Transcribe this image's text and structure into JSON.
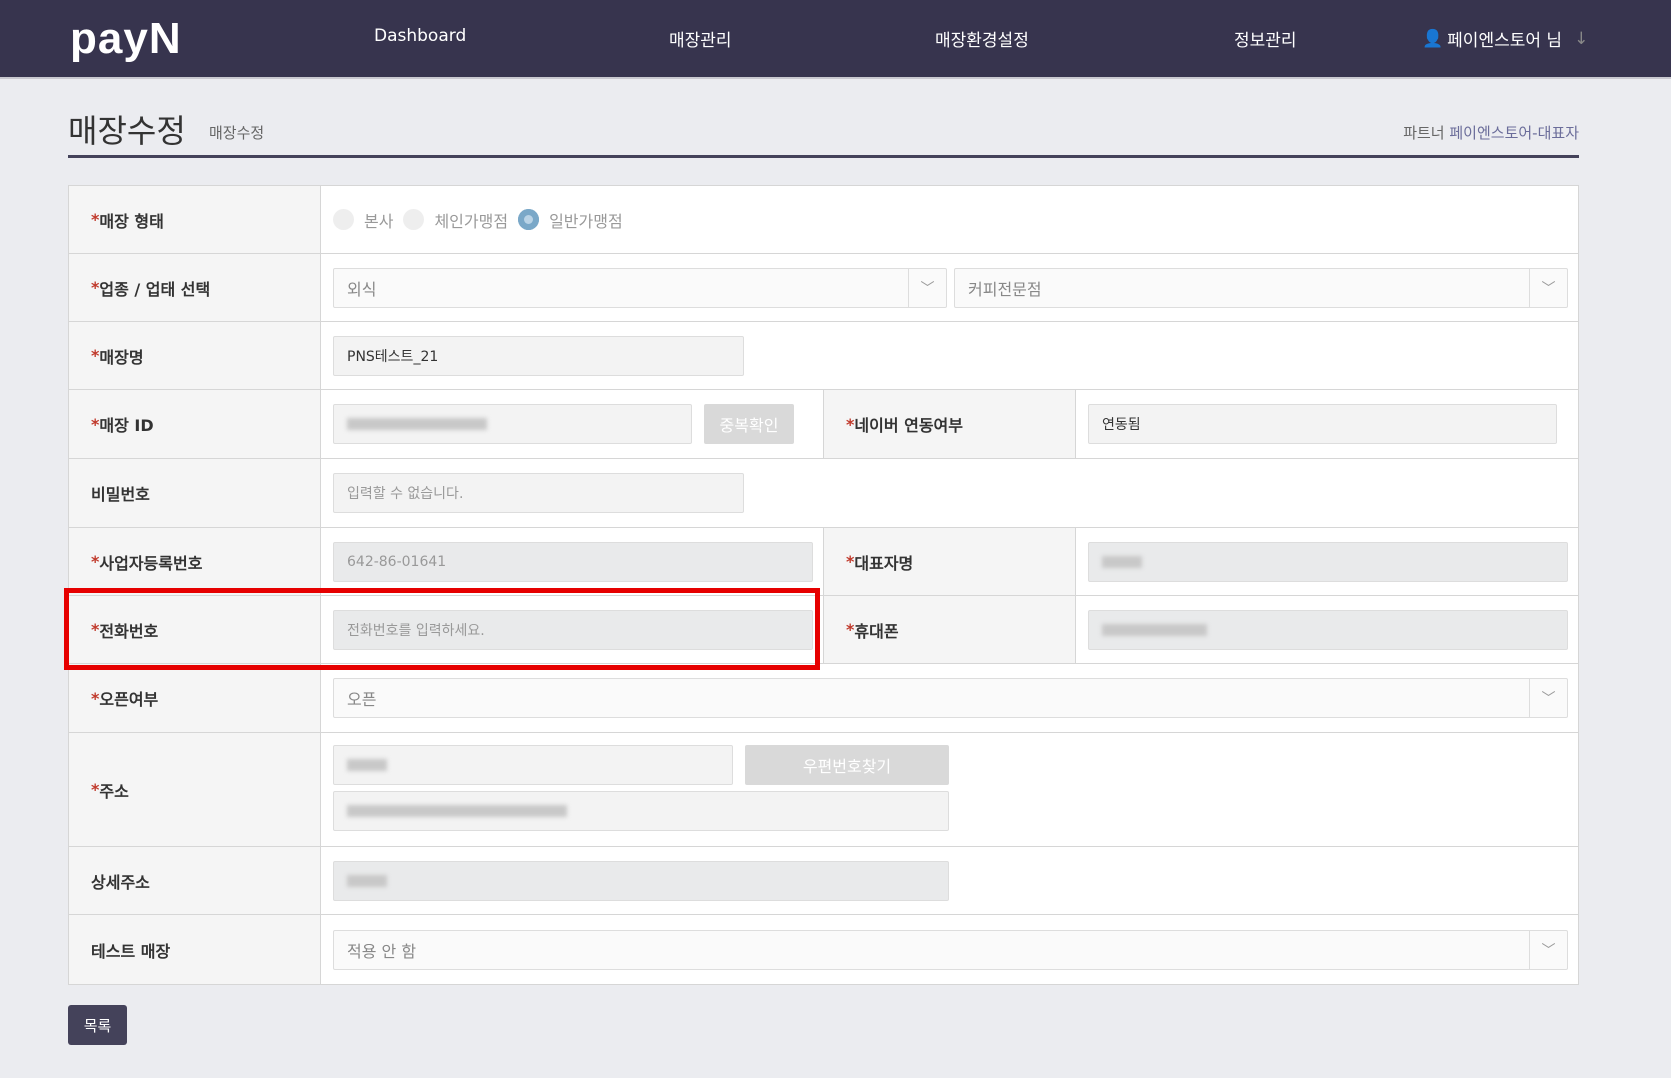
{
  "header": {
    "logo": "payN",
    "nav": [
      "Dashboard",
      "매장관리",
      "매장환경설정",
      "정보관리"
    ],
    "user": "페이엔스토어 님"
  },
  "page": {
    "title": "매장수정",
    "subtitle": "매장수정",
    "partner_label": "파트너",
    "partner_name": "페이엔스토어-대표자"
  },
  "form": {
    "store_type": {
      "label": "매장 형태",
      "options": [
        "본사",
        "체인가맹점",
        "일반가맹점"
      ],
      "selected": "일반가맹점"
    },
    "business": {
      "label": "업종 / 업태 선택",
      "category": "외식",
      "subcategory": "커피전문점"
    },
    "store_name": {
      "label": "매장명",
      "value": "PNS테스트_21"
    },
    "store_id": {
      "label": "매장 ID",
      "check_button": "중복확인"
    },
    "naver": {
      "label": "네이버 연동여부",
      "value": "연동됨"
    },
    "password": {
      "label": "비밀번호",
      "placeholder": "입력할 수 없습니다."
    },
    "biz_no": {
      "label": "사업자등록번호",
      "value": "642-86-01641"
    },
    "ceo": {
      "label": "대표자명"
    },
    "phone": {
      "label": "전화번호",
      "placeholder": "전화번호를 입력하세요."
    },
    "mobile": {
      "label": "휴대폰"
    },
    "open": {
      "label": "오픈여부",
      "value": "오픈"
    },
    "address": {
      "label": "주소",
      "zip_button": "우편번호찾기"
    },
    "detail_address": {
      "label": "상세주소"
    },
    "test_store": {
      "label": "테스트 매장",
      "value": "적용 안 함"
    }
  },
  "footer": {
    "list_button": "목록"
  },
  "colors": {
    "header": "#37344e",
    "highlight": "#e60000",
    "required": "#c0392b"
  }
}
